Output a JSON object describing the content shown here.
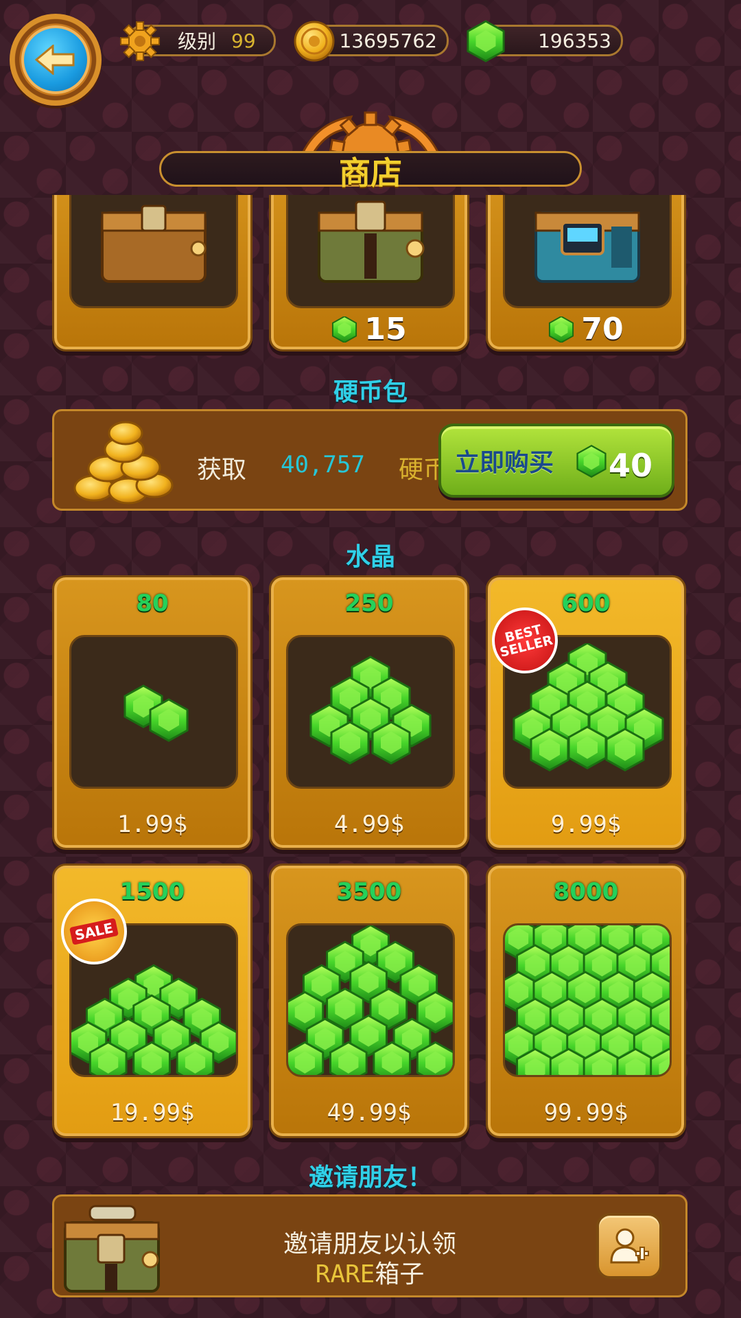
{
  "header": {
    "level_label": "级别",
    "level_value": "99",
    "coins": "13695762",
    "gems": "196353"
  },
  "title": "商店",
  "chests": [
    {
      "price": ""
    },
    {
      "price": "15"
    },
    {
      "price": "70"
    }
  ],
  "coin_pack": {
    "section_title": "硬币包",
    "get_label": "获取",
    "amount": "40,757",
    "unit": "硬币",
    "buy_label": "立即购买",
    "price": "40"
  },
  "crystals": {
    "section_title": "水晶",
    "items": [
      {
        "amount": "80",
        "price": "1.99$"
      },
      {
        "amount": "250",
        "price": "4.99$"
      },
      {
        "amount": "600",
        "price": "9.99$",
        "badge": "BEST SELLER"
      },
      {
        "amount": "1500",
        "price": "19.99$",
        "badge": "SALE"
      },
      {
        "amount": "3500",
        "price": "49.99$"
      },
      {
        "amount": "8000",
        "price": "99.99$"
      }
    ]
  },
  "invite": {
    "section_title": "邀请朋友！",
    "line1": "邀请朋友以认领",
    "rare": "RARE",
    "line2_suffix": "箱子"
  },
  "colors": {
    "gem_green": "#3fd84a",
    "title_yellow": "#f3cf2e",
    "section_cyan": "#30d0e8",
    "card_gold": "#d8961e"
  }
}
